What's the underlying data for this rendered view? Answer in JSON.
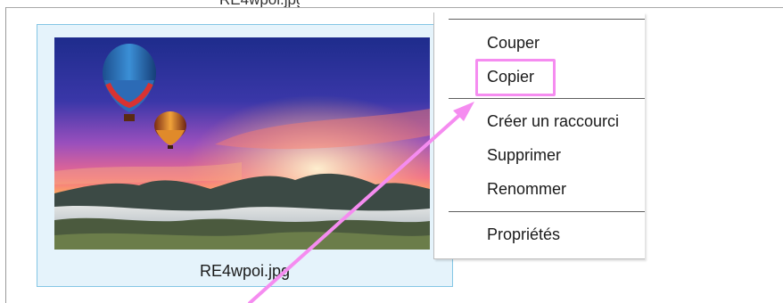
{
  "file": {
    "name": "RE4wpoi.jpg",
    "previous_caption": "RE4wpoi.jpg"
  },
  "context_menu": {
    "items": [
      {
        "label": "Couper"
      },
      {
        "label": "Copier"
      },
      {
        "label": "Créer un raccourci"
      },
      {
        "label": "Supprimer"
      },
      {
        "label": "Renommer"
      },
      {
        "label": "Propriétés"
      }
    ],
    "highlighted_item": "Copier"
  },
  "colors": {
    "selection_fill": "#e5f3fb",
    "selection_border": "#84c6e5",
    "annotation": "#f58cf0"
  }
}
